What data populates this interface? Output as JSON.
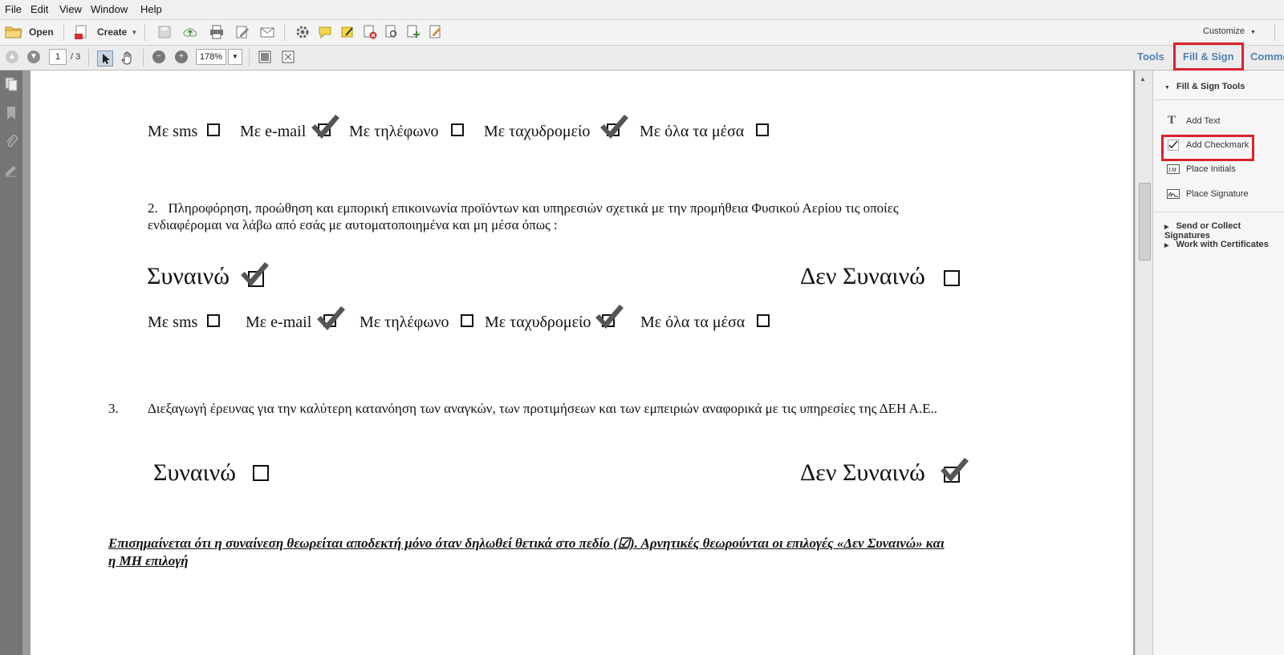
{
  "menu": [
    "File",
    "Edit",
    "View",
    "Window",
    "Help"
  ],
  "toolbar": {
    "open_label": "Open",
    "create_label": "Create",
    "customize_label": "Customize"
  },
  "nav": {
    "page_current": "1",
    "page_total": "/ 3",
    "zoom": "178%"
  },
  "pane_tabs": {
    "tools": "Tools",
    "fill_sign": "Fill & Sign",
    "comment": "Comme"
  },
  "right_pane": {
    "section_title": "Fill & Sign Tools",
    "items": [
      {
        "label": "Add Text",
        "icon": "text-icon"
      },
      {
        "label": "Add Checkmark",
        "icon": "checkmark-icon"
      },
      {
        "label": "Place Initials",
        "icon": "initials-icon"
      },
      {
        "label": "Place Signature",
        "icon": "signature-icon"
      }
    ],
    "collapsed_sections": [
      "Send or Collect Signatures",
      "Work with Certificates"
    ]
  },
  "document": {
    "row1": {
      "options": [
        {
          "label": "Με sms",
          "checked": false
        },
        {
          "label": "Με e-mail",
          "checked": true
        },
        {
          "label": "Με τηλέφωνο",
          "checked": false
        },
        {
          "label": "Με  ταχυδρομείο",
          "checked": true
        },
        {
          "label": "Με όλα τα μέσα",
          "checked": false
        }
      ]
    },
    "section2": {
      "number": "2.",
      "line1": "Πληροφόρηση, προώθηση και εμπορική επικοινωνία προϊόντων και υπηρεσιών σχετικά με την προμήθεια  Φυσικού Αερίου τις οποίες",
      "line2": "ενδιαφέρομαι να λάβω από εσάς με αυτοματοποιημένα και μη μέσα όπως :",
      "agree": {
        "label": "Συναινώ",
        "checked": true
      },
      "disagree": {
        "label": "Δεν Συναινώ",
        "checked": false
      },
      "options": [
        {
          "label": "Με sms",
          "checked": false
        },
        {
          "label": "Με e-mail",
          "checked": true
        },
        {
          "label": "Με τηλέφωνο",
          "checked": false
        },
        {
          "label": "Με ταχυδρομείο",
          "checked": true
        },
        {
          "label": "Με όλα τα μέσα",
          "checked": false
        }
      ]
    },
    "section3": {
      "number": "3.",
      "text": "Διεξαγωγή έρευνας για την καλύτερη κατανόηση των αναγκών, των προτιμήσεων και  των εμπειριών αναφορικά με τις υπηρεσίες της ΔΕΗ Α.Ε..",
      "agree": {
        "label": "Συναινώ",
        "checked": false
      },
      "disagree": {
        "label": "Δεν Συναινώ",
        "checked": true
      }
    },
    "note_line1": "Επισημαίνεται ότι η συναίνεση θεωρείται αποδεκτή μόνο όταν δηλωθεί θετικά στο πεδίο (☑). Αρνητικές θεωρούνται οι επιλογές «Δεν Συναινώ» και",
    "note_line2": "η ΜΗ επιλογή"
  }
}
